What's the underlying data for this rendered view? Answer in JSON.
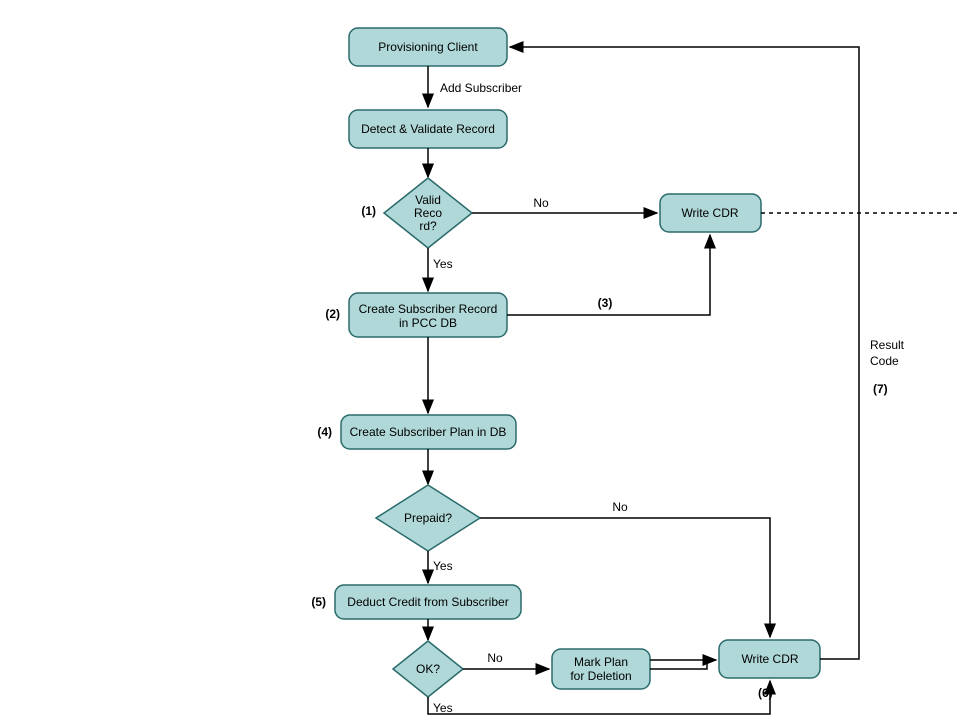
{
  "nodes": {
    "provisioning": "Provisioning Client",
    "detect": "Detect & Validate Record",
    "valid1": "Valid",
    "valid2": "Reco",
    "valid3": "rd?",
    "writeCdr1": "Write CDR",
    "createRecord1": "Create Subscriber Record",
    "createRecord2": "in PCC DB",
    "createPlan": "Create Subscriber Plan in DB",
    "prepaid": "Prepaid?",
    "deduct": "Deduct Credit from Subscriber",
    "ok": "OK?",
    "markPlan1": "Mark Plan",
    "markPlan2": "for Deletion",
    "writeCdr2": "Write CDR"
  },
  "edges": {
    "addSubscriber": "Add Subscriber",
    "yes": "Yes",
    "no": "No",
    "resultCode1": "Result",
    "resultCode2": "Code"
  },
  "annotations": {
    "n1": "(1)",
    "n2": "(2)",
    "n3": "(3)",
    "n4": "(4)",
    "n5": "(5)",
    "n6": "(6)",
    "n7": "(7)"
  }
}
